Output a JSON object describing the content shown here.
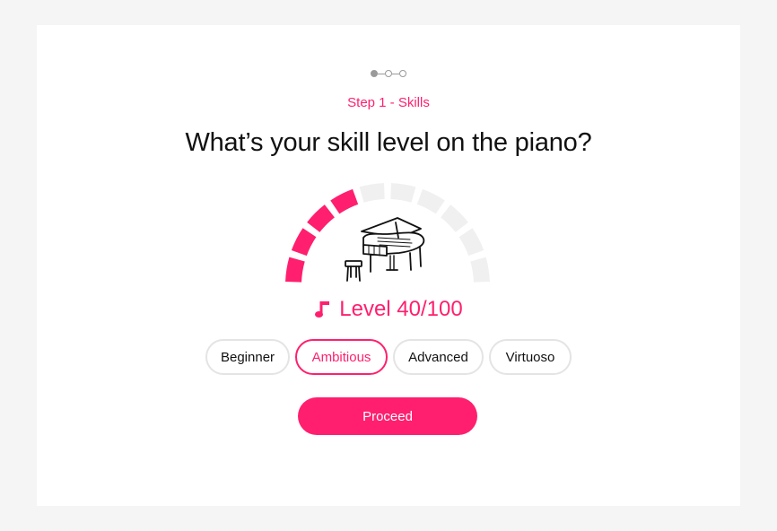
{
  "stepper": {
    "total_steps": 3,
    "current_step": 1
  },
  "step_label": "Step 1 - Skills",
  "question": "What’s your skill level on the piano?",
  "gauge": {
    "level_value": 40,
    "level_max": 100,
    "total_segments": 10,
    "filled_segments": 4,
    "filled_color": "#ff1f6e",
    "empty_color": "#f0f0f0",
    "icon": "grand-piano-icon"
  },
  "level_label": "Level 40/100",
  "level_icon": "music-note-icon",
  "options": [
    {
      "label": "Beginner",
      "selected": false
    },
    {
      "label": "Ambitious",
      "selected": true
    },
    {
      "label": "Advanced",
      "selected": false
    },
    {
      "label": "Virtuoso",
      "selected": false
    }
  ],
  "proceed_label": "Proceed",
  "colors": {
    "accent": "#ff1f6e",
    "text": "#111111",
    "background": "#f5f5f5"
  }
}
